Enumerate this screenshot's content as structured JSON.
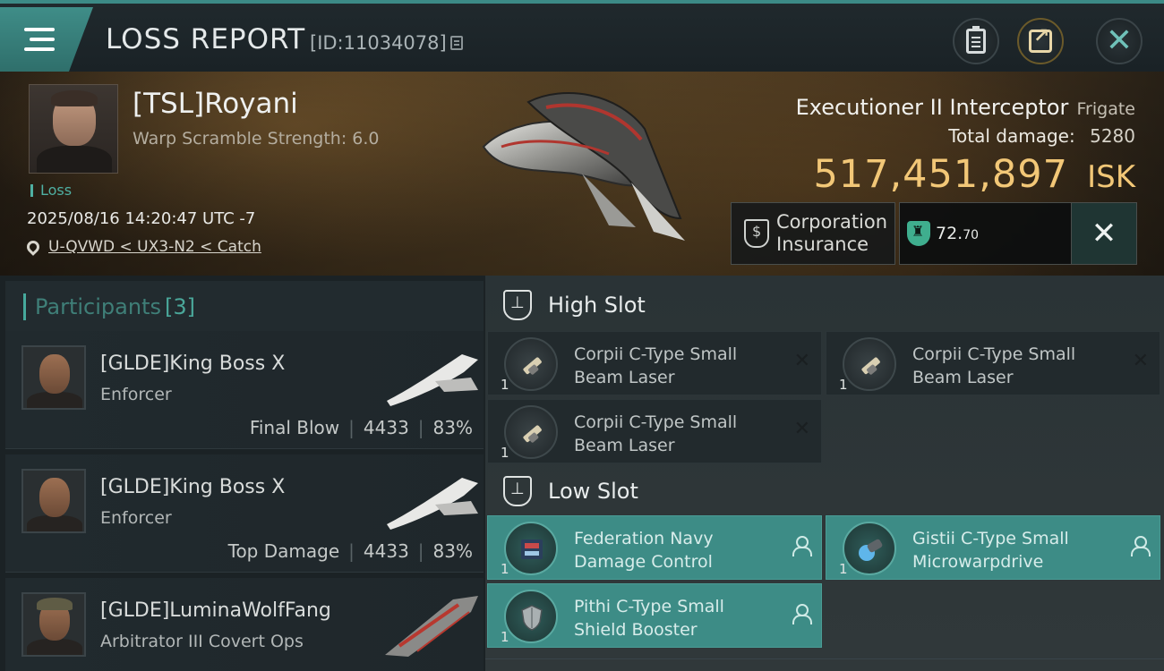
{
  "header": {
    "title": "LOSS REPORT",
    "report_id": "[ID:11034078]"
  },
  "victim": {
    "name": "[TSL]Royani",
    "warp_scramble": "Warp Scramble Strength: 6.0",
    "loss_label": "Loss",
    "date": "2025/08/16 14:20:47 UTC -7",
    "location": "U-QVWD < UX3-N2 < Catch"
  },
  "ship": {
    "name": "Executioner II Interceptor",
    "class": "Frigate",
    "total_damage_label": "Total damage:",
    "total_damage_value": "5280",
    "isk_value": "517,451,897",
    "isk_unit": "ISK"
  },
  "insurance": {
    "label_line1": "Corporation",
    "label_line2": "Insurance",
    "security_value": "72.",
    "security_decimal": "70"
  },
  "participants": {
    "label": "Participants",
    "count": "[3]",
    "rows": [
      {
        "name": "[GLDE]King Boss X",
        "ship": "Enforcer",
        "role": "Final Blow",
        "damage": "4433",
        "percent": "83%"
      },
      {
        "name": "[GLDE]King Boss X",
        "ship": "Enforcer",
        "role": "Top Damage",
        "damage": "4433",
        "percent": "83%"
      },
      {
        "name": "[GLDE]LuminaWolfFang",
        "ship": "Arbitrator III Covert Ops"
      }
    ]
  },
  "slots": {
    "high": {
      "label": "High Slot",
      "items": [
        {
          "line1": "Corpii C-Type Small",
          "line2": "Beam Laser",
          "qty": "1"
        },
        {
          "line1": "Corpii C-Type Small",
          "line2": "Beam Laser",
          "qty": "1"
        },
        {
          "line1": "Corpii C-Type Small",
          "line2": "Beam Laser",
          "qty": "1"
        }
      ]
    },
    "low": {
      "label": "Low Slot",
      "items": [
        {
          "line1": "Federation Navy",
          "line2": "Damage Control",
          "qty": "1"
        },
        {
          "line1": "Gistii C-Type Small",
          "line2": "Microwarpdrive",
          "qty": "1"
        },
        {
          "line1": "Pithi C-Type Small",
          "line2": "Shield Booster",
          "qty": "1"
        }
      ]
    }
  },
  "colors": {
    "accent": "#3d8c86",
    "isk": "#f2c777"
  }
}
